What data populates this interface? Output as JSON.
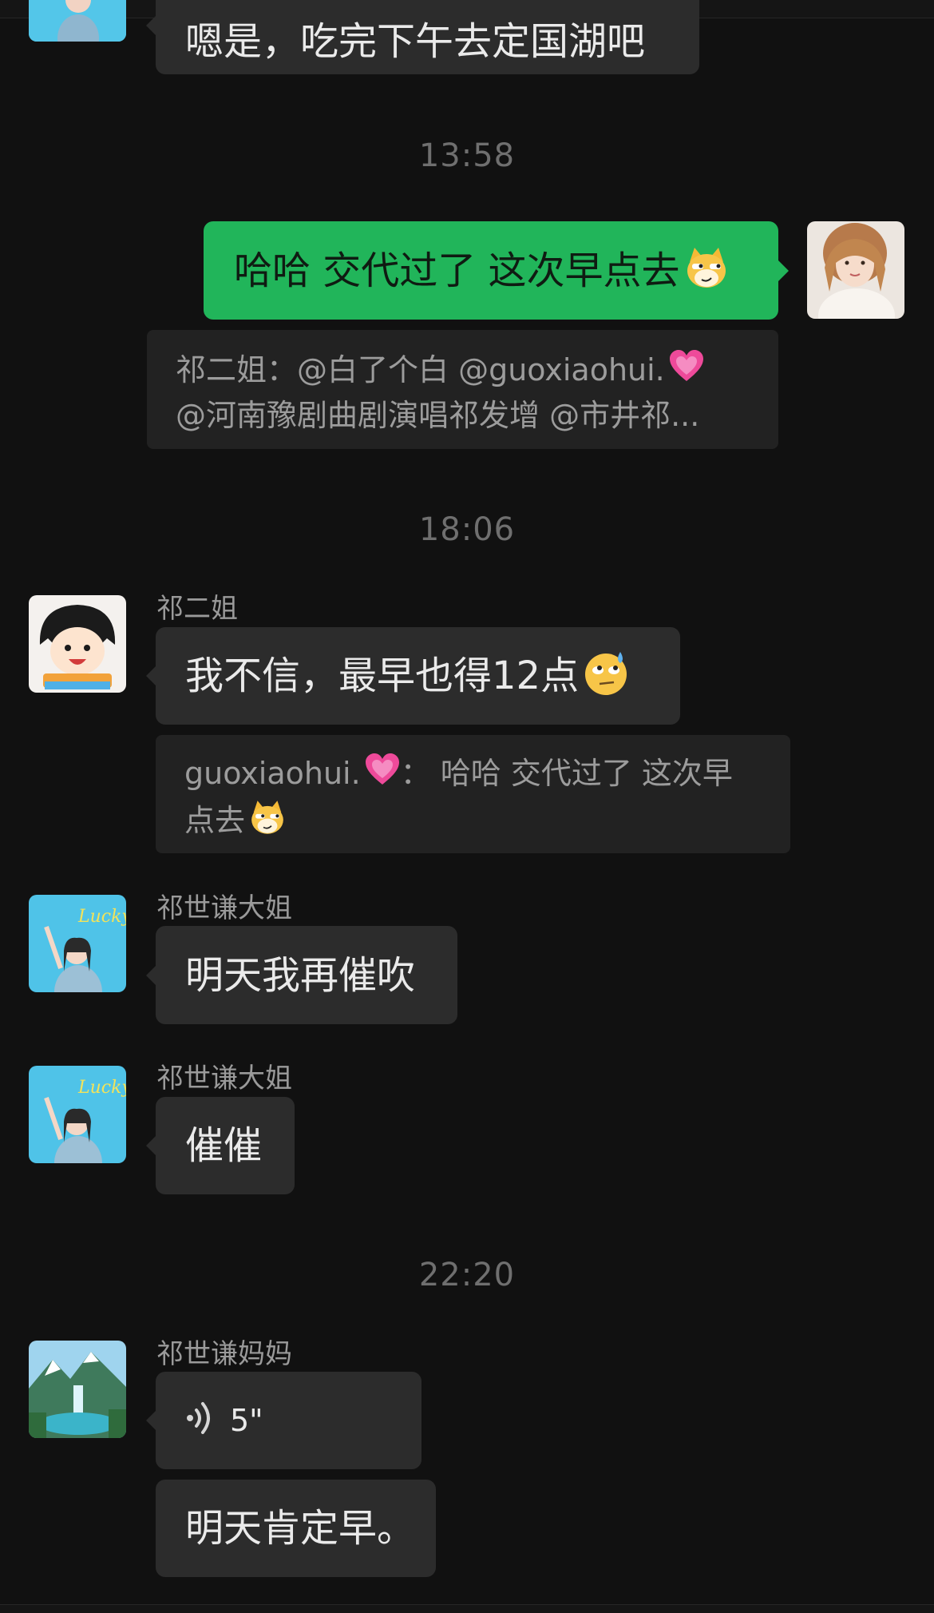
{
  "times": [
    "13:58",
    "18:06",
    "22:20"
  ],
  "messages": [
    {
      "sender": "",
      "text": "嗯是，吃完下午去定国湖吧"
    },
    {
      "sender": "me",
      "text": "哈哈 交代过了 这次早点去",
      "emoji": "cat-smirk-emoji"
    },
    {
      "sender": "me",
      "quote_line1": "祁二姐：@白了个白 @guoxiaohui.",
      "quote_line2": "@河南豫剧曲剧演唱祁发增 @市井祁..."
    },
    {
      "sender": "祁二姐",
      "text": "我不信，最早也得12点",
      "emoji": "sweat-rolling-eyes-emoji"
    },
    {
      "quote_line1": "guoxiaohui.",
      "quote_line1_tail": "：  哈哈 交代过了 这次早",
      "quote_line2": "点去"
    },
    {
      "sender": "祁世谦大姐",
      "text": "明天我再催吹"
    },
    {
      "sender": "祁世谦大姐",
      "text": "催催"
    },
    {
      "sender": "祁世谦妈妈",
      "voice_duration": "5\"",
      "text": "明天肯定早。"
    }
  ],
  "colors": {
    "background": "#111111",
    "bubble_other": "#2c2c2c",
    "bubble_mine": "#21b55a",
    "quote": "#222222",
    "timestamp": "#6f6f6f"
  }
}
